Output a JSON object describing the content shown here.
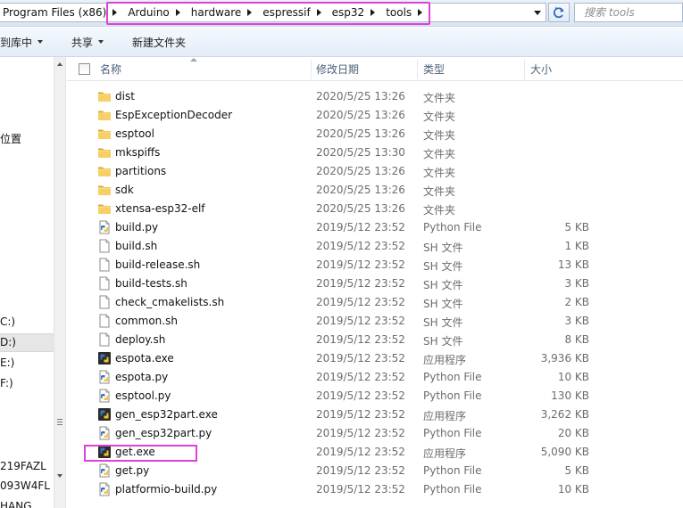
{
  "address": {
    "crumbs": [
      "Program Files (x86)",
      "Arduino",
      "hardware",
      "espressif",
      "esp32",
      "tools"
    ],
    "search_placeholder": "搜索 tools"
  },
  "toolbar": {
    "include_library": "到库中",
    "share": "共享",
    "new_folder": "新建文件夹"
  },
  "nav": {
    "items": [
      {
        "label": "位置"
      },
      {
        "label": "C:)"
      },
      {
        "label": "D:)"
      },
      {
        "label": "E:)"
      },
      {
        "label": "F:)"
      },
      {
        "label": "219FAZL"
      },
      {
        "label": "093W4FL"
      },
      {
        "label": "HANG"
      }
    ]
  },
  "columns": {
    "name": "名称",
    "date": "修改日期",
    "type": "类型",
    "size": "大小"
  },
  "files": [
    {
      "name": "dist",
      "date": "2020/5/25 13:26",
      "type": "文件夹",
      "size": "",
      "icon": "folder-icon"
    },
    {
      "name": "EspExceptionDecoder",
      "date": "2020/5/25 13:26",
      "type": "文件夹",
      "size": "",
      "icon": "folder-icon"
    },
    {
      "name": "esptool",
      "date": "2020/5/25 13:26",
      "type": "文件夹",
      "size": "",
      "icon": "folder-icon"
    },
    {
      "name": "mkspiffs",
      "date": "2020/5/25 13:30",
      "type": "文件夹",
      "size": "",
      "icon": "folder-icon"
    },
    {
      "name": "partitions",
      "date": "2020/5/25 13:26",
      "type": "文件夹",
      "size": "",
      "icon": "folder-icon"
    },
    {
      "name": "sdk",
      "date": "2020/5/25 13:26",
      "type": "文件夹",
      "size": "",
      "icon": "folder-icon"
    },
    {
      "name": "xtensa-esp32-elf",
      "date": "2020/5/25 13:26",
      "type": "文件夹",
      "size": "",
      "icon": "folder-icon"
    },
    {
      "name": "build.py",
      "date": "2019/5/12 23:52",
      "type": "Python File",
      "size": "5 KB",
      "icon": "python-file-icon"
    },
    {
      "name": "build.sh",
      "date": "2019/5/12 23:52",
      "type": "SH 文件",
      "size": "1 KB",
      "icon": "blank-file-icon"
    },
    {
      "name": "build-release.sh",
      "date": "2019/5/12 23:52",
      "type": "SH 文件",
      "size": "13 KB",
      "icon": "blank-file-icon"
    },
    {
      "name": "build-tests.sh",
      "date": "2019/5/12 23:52",
      "type": "SH 文件",
      "size": "3 KB",
      "icon": "blank-file-icon"
    },
    {
      "name": "check_cmakelists.sh",
      "date": "2019/5/12 23:52",
      "type": "SH 文件",
      "size": "2 KB",
      "icon": "blank-file-icon"
    },
    {
      "name": "common.sh",
      "date": "2019/5/12 23:52",
      "type": "SH 文件",
      "size": "3 KB",
      "icon": "blank-file-icon"
    },
    {
      "name": "deploy.sh",
      "date": "2019/5/12 23:52",
      "type": "SH 文件",
      "size": "8 KB",
      "icon": "blank-file-icon"
    },
    {
      "name": "espota.exe",
      "date": "2019/5/12 23:52",
      "type": "应用程序",
      "size": "3,936 KB",
      "icon": "python-exe-icon"
    },
    {
      "name": "espota.py",
      "date": "2019/5/12 23:52",
      "type": "Python File",
      "size": "10 KB",
      "icon": "python-file-icon"
    },
    {
      "name": "esptool.py",
      "date": "2019/5/12 23:52",
      "type": "Python File",
      "size": "130 KB",
      "icon": "python-file-icon"
    },
    {
      "name": "gen_esp32part.exe",
      "date": "2019/5/12 23:52",
      "type": "应用程序",
      "size": "3,262 KB",
      "icon": "python-exe-icon"
    },
    {
      "name": "gen_esp32part.py",
      "date": "2019/5/12 23:52",
      "type": "Python File",
      "size": "20 KB",
      "icon": "python-file-icon"
    },
    {
      "name": "get.exe",
      "date": "2019/5/12 23:52",
      "type": "应用程序",
      "size": "5,090 KB",
      "icon": "python-exe-icon"
    },
    {
      "name": "get.py",
      "date": "2019/5/12 23:52",
      "type": "Python File",
      "size": "5 KB",
      "icon": "python-file-icon"
    },
    {
      "name": "platformio-build.py",
      "date": "2019/5/12 23:52",
      "type": "Python File",
      "size": "10 KB",
      "icon": "python-file-icon"
    }
  ],
  "colors": {
    "highlight": "#e040d8",
    "folder": "#f1c84b",
    "header_text": "#4c607a"
  }
}
